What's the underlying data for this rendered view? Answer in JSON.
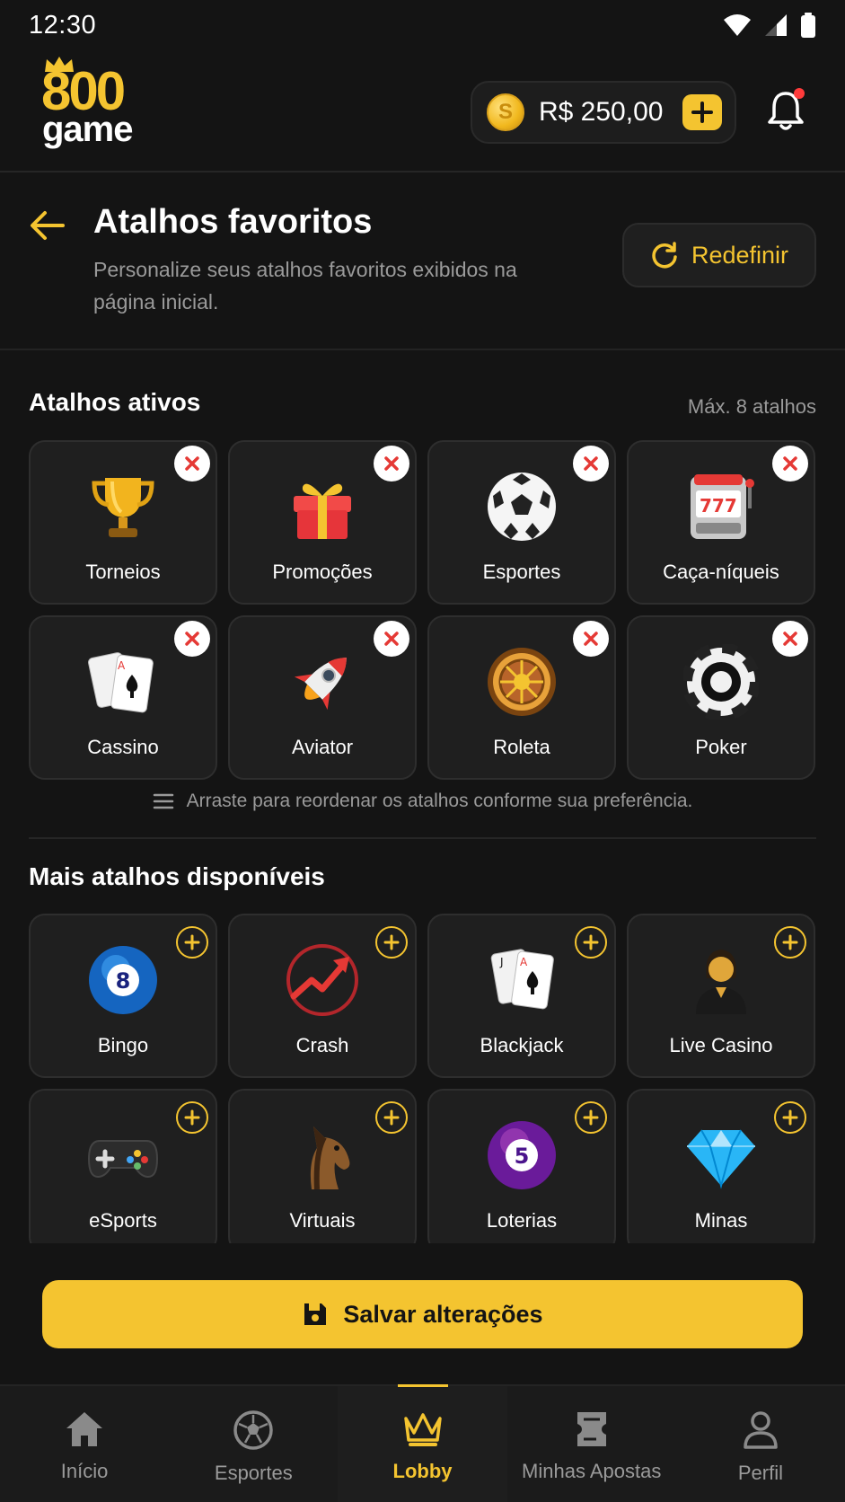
{
  "status": {
    "time": "12:30"
  },
  "header": {
    "logo_top": "800",
    "logo_bottom": "game",
    "coin_symbol": "S",
    "balance": "R$ 250,00"
  },
  "page": {
    "title": "Atalhos favoritos",
    "subtitle": "Personalize seus atalhos favoritos exibidos na página inicial.",
    "reset_label": "Redefinir"
  },
  "active_section": {
    "title": "Atalhos ativos",
    "note": "Máx. 8 atalhos",
    "items": [
      {
        "label": "Torneios",
        "icon": "trophy-icon"
      },
      {
        "label": "Promoções",
        "icon": "gift-icon"
      },
      {
        "label": "Esportes",
        "icon": "soccer-ball-icon"
      },
      {
        "label": "Caça-níqueis",
        "icon": "slot-machine-icon"
      },
      {
        "label": "Cassino",
        "icon": "playing-cards-icon"
      },
      {
        "label": "Aviator",
        "icon": "rocket-icon"
      },
      {
        "label": "Roleta",
        "icon": "roulette-wheel-icon"
      },
      {
        "label": "Poker",
        "icon": "poker-chip-icon"
      }
    ],
    "hint": "Arraste para reordenar os atalhos conforme sua preferência."
  },
  "more_section": {
    "title": "Mais atalhos disponíveis",
    "items": [
      {
        "label": "Bingo",
        "icon": "bingo-ball-icon",
        "ball_number": "8"
      },
      {
        "label": "Crash",
        "icon": "crash-chart-icon"
      },
      {
        "label": "Blackjack",
        "icon": "blackjack-cards-icon"
      },
      {
        "label": "Live Casino",
        "icon": "live-dealer-icon"
      },
      {
        "label": "eSports",
        "icon": "gamepad-icon"
      },
      {
        "label": "Virtuais",
        "icon": "horse-icon"
      },
      {
        "label": "Loterias",
        "icon": "lottery-ball-icon",
        "ball_number": "5"
      },
      {
        "label": "Minas",
        "icon": "diamond-icon"
      }
    ]
  },
  "save_label": "Salvar alterações",
  "nav": {
    "items": [
      {
        "label": "Início",
        "icon": "home-icon"
      },
      {
        "label": "Esportes",
        "icon": "soccer-icon"
      },
      {
        "label": "Lobby",
        "icon": "crown-icon",
        "active": true
      },
      {
        "label": "Minhas Apostas",
        "icon": "bet-slip-icon"
      },
      {
        "label": "Perfil",
        "icon": "profile-icon"
      }
    ]
  },
  "colors": {
    "accent": "#f4c430",
    "background": "#141414",
    "tile": "#1f1f1f",
    "danger": "#e53935"
  }
}
